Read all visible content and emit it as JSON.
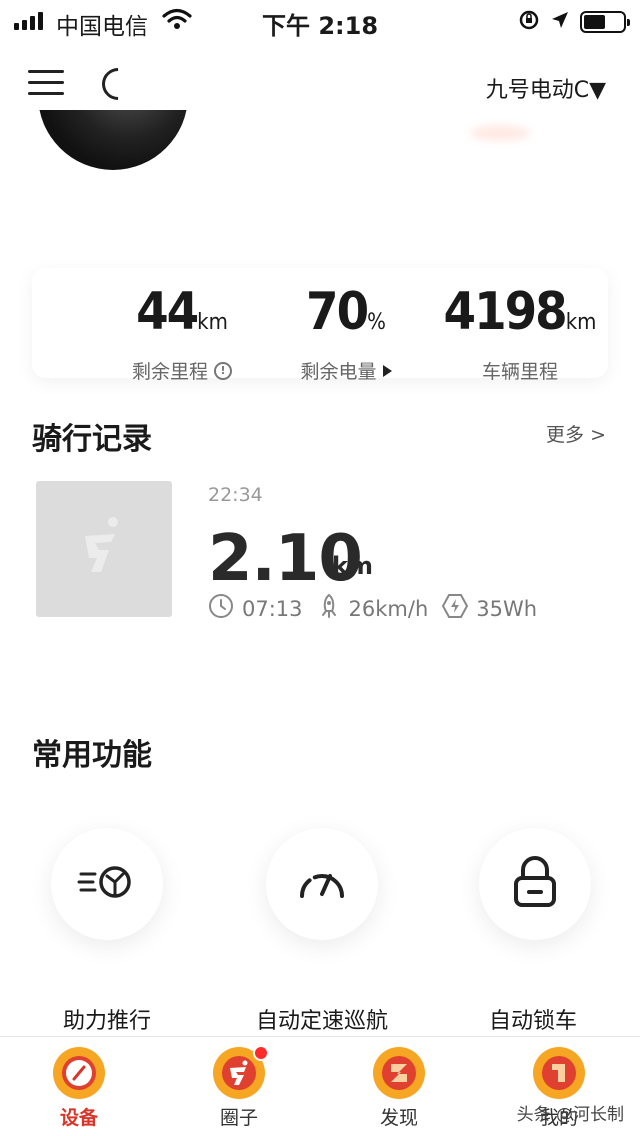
{
  "status_bar": {
    "carrier": "中国电信",
    "time": "下午 2:18"
  },
  "header": {
    "device_name": "九号电动C▼"
  },
  "stats": {
    "remaining_range": {
      "value": "44",
      "unit": "km",
      "label": "剩余里程"
    },
    "battery": {
      "value": "70",
      "unit": "%",
      "label": "剩余电量"
    },
    "odometer": {
      "value": "4198",
      "unit": "km",
      "label": "车辆里程"
    }
  },
  "ride_record": {
    "title": "骑行记录",
    "more_label": "更多 >",
    "ride": {
      "time": "22:34",
      "distance": "2.10",
      "distance_unit": "km",
      "duration": "07:13",
      "speed": "26km/h",
      "energy": "35Wh"
    }
  },
  "functions": {
    "title": "常用功能",
    "items": [
      {
        "label": "助力推行",
        "icon": "push-assist-icon"
      },
      {
        "label": "自动定速巡航",
        "icon": "speedometer-icon"
      },
      {
        "label": "自动锁车",
        "icon": "lock-icon"
      }
    ]
  },
  "tab_bar": {
    "tabs": [
      {
        "label": "设备",
        "active": true,
        "color": "#d9362b"
      },
      {
        "label": "圈子",
        "active": false
      },
      {
        "label": "发现",
        "active": false
      },
      {
        "label": "我的",
        "active": false
      }
    ]
  },
  "watermark": "头条 @河长制",
  "colors": {
    "accent": "#d9362b",
    "tab_icon_orange": "#f6a623",
    "badge": "#ff2a2a"
  }
}
